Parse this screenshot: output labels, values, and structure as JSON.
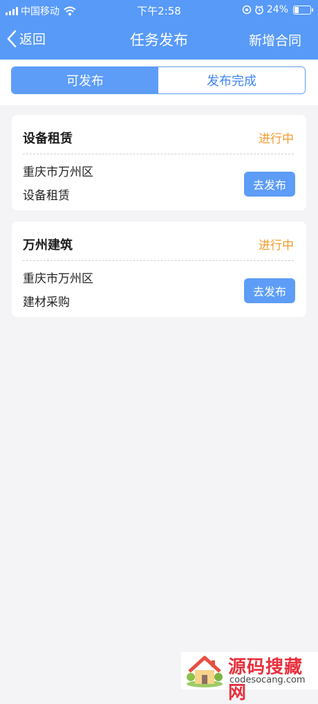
{
  "status_bar": {
    "carrier": "中国移动",
    "time": "下午2:58",
    "battery": "24%",
    "battery_level": 0.24
  },
  "nav": {
    "back_label": "返回",
    "title": "任务发布",
    "right_action": "新增合同"
  },
  "tabs": [
    {
      "label": "可发布",
      "active": true
    },
    {
      "label": "发布完成",
      "active": false
    }
  ],
  "cards": [
    {
      "title": "设备租赁",
      "status": "进行中",
      "location": "重庆市万州区",
      "category": "设备租赁",
      "button": "去发布"
    },
    {
      "title": "万州建筑",
      "status": "进行中",
      "location": "重庆市万州区",
      "category": "建材采购",
      "button": "去发布"
    }
  ],
  "watermark": {
    "title": "源码搜藏网",
    "subtitle": "codesocang.com"
  },
  "colors": {
    "primary": "#589af8",
    "status_in_progress": "#f39a2b",
    "background": "#f4f4f6"
  }
}
